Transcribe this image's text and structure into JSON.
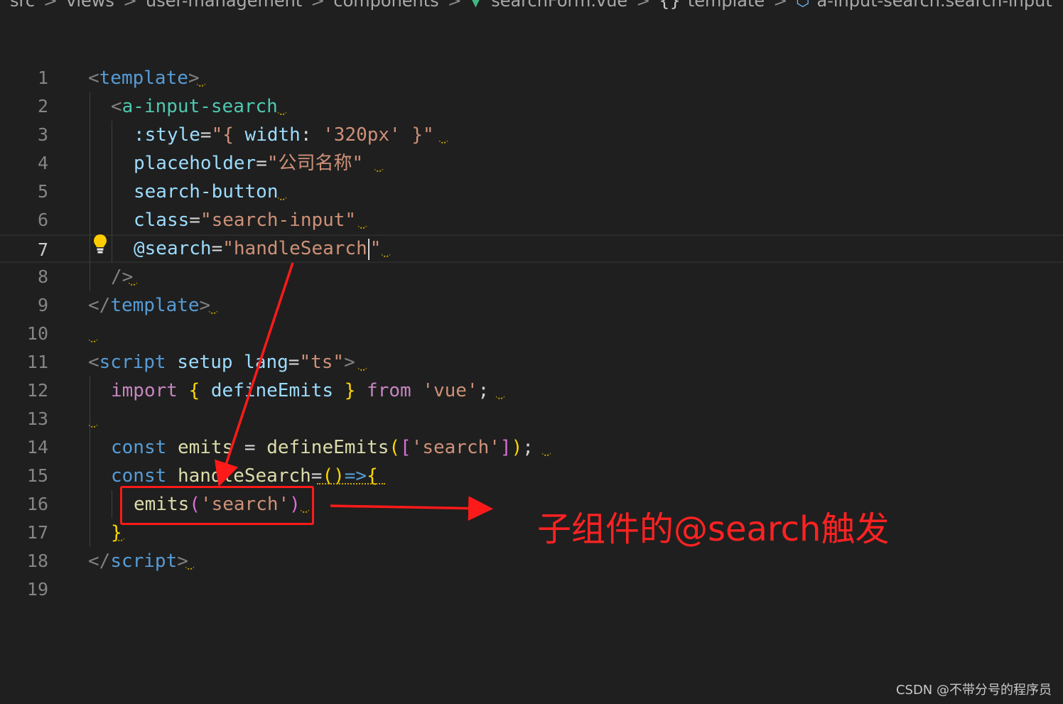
{
  "breadcrumb": {
    "items": [
      "src",
      "views",
      "user-management",
      "components",
      "searchForm.vue",
      "template",
      "a-input-search.search-input"
    ],
    "icons": [
      "vue-file-icon",
      "braces-icon",
      "cube-icon"
    ]
  },
  "editor": {
    "active_line": 7,
    "lines": [
      {
        "n": "1"
      },
      {
        "n": "2"
      },
      {
        "n": "3"
      },
      {
        "n": "4"
      },
      {
        "n": "5"
      },
      {
        "n": "6"
      },
      {
        "n": "7"
      },
      {
        "n": "8"
      },
      {
        "n": "9"
      },
      {
        "n": "10"
      },
      {
        "n": "11"
      },
      {
        "n": "12"
      },
      {
        "n": "13"
      },
      {
        "n": "14"
      },
      {
        "n": "15"
      },
      {
        "n": "16"
      },
      {
        "n": "17"
      },
      {
        "n": "18"
      },
      {
        "n": "19"
      }
    ],
    "tokens": {
      "l1_tag": "template",
      "l2_tag": "a-input-search",
      "l3_attr": ":style",
      "l3_val_open": "\"{ ",
      "l3_key": "width",
      "l3_val": "'320px'",
      "l3_close": " }\"",
      "l4_attr": "placeholder",
      "l4_val": "\"公司名称\"",
      "l5_attr": "search-button",
      "l6_attr": "class",
      "l6_val": "\"search-input\"",
      "l7_attr": "@search",
      "l7_val_a": "\"handleSearch",
      "l7_val_b": "\"",
      "l8_close": "/>",
      "l9_tag": "template",
      "l11_tag": "script",
      "l11_attr1": "setup",
      "l11_attr2": "lang",
      "l11_val": "\"ts\"",
      "l12_import": "import",
      "l12_name": "defineEmits",
      "l12_from": "from",
      "l12_mod": "'vue'",
      "l14_const": "const",
      "l14_var": "emits",
      "l14_fn": "defineEmits",
      "l14_str": "'search'",
      "l15_const": "const",
      "l15_var": "handleSearch",
      "l15_arrow": "=>",
      "l16_fn": "emits",
      "l16_str": "'search'",
      "l17_close": "}",
      "l18_tag": "script"
    }
  },
  "annotation": {
    "text": "子组件的@search触发",
    "color": "#ff2222"
  },
  "watermark": "CSDN @不带分号的程序员",
  "colors": {
    "background": "#1f1f1f",
    "tag": "#569cd6",
    "attr": "#9cdcfe",
    "string": "#ce9178",
    "keyword": "#c586c0",
    "function": "#dcdcaa",
    "arrow": "#ff1a1a"
  }
}
